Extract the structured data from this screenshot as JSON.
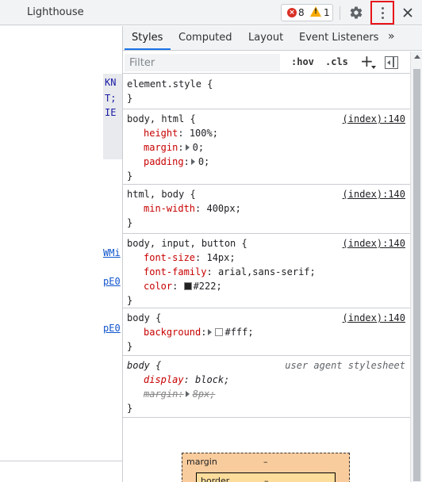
{
  "toolbar": {
    "panel_tab": "Lighthouse",
    "error_count": "8",
    "warning_count": "1",
    "icons": [
      "error-icon",
      "warning-icon",
      "gear-icon",
      "kebab-menu-icon",
      "close-icon"
    ],
    "highlight_color": "#e8151b"
  },
  "elements_pane": {
    "code_fragments": [
      "KN",
      "T;",
      "IE"
    ],
    "links": [
      "WMi",
      "pE0",
      "pE0"
    ]
  },
  "sidebar_tabs": {
    "styles": "Styles",
    "computed": "Computed",
    "layout": "Layout",
    "event_listeners": "Event Listeners",
    "more": "»"
  },
  "filter": {
    "placeholder": "Filter",
    "hov": ":hov",
    "cls": ".cls",
    "new_rule": "+"
  },
  "rules": {
    "r0": {
      "selector": "element.style {",
      "close": "}"
    },
    "r1": {
      "selector": "body, html {",
      "source": "(index):140",
      "close": "}",
      "p1": {
        "name": "height",
        "value": "100%;"
      },
      "p2": {
        "name": "margin",
        "value": "0;"
      },
      "p3": {
        "name": "padding",
        "value": "0;"
      }
    },
    "r2": {
      "selector": "html, body {",
      "source": "(index):140",
      "close": "}",
      "p1": {
        "name": "min-width",
        "value": "400px;"
      }
    },
    "r3": {
      "selector": "body, input, button {",
      "source": "(index):140",
      "close": "}",
      "p1": {
        "name": "font-size",
        "value": "14px;"
      },
      "p2": {
        "name": "font-family",
        "value": "arial,sans-serif;"
      },
      "p3": {
        "name": "color",
        "value": "#222;",
        "swatch": "#222222"
      }
    },
    "r4": {
      "selector": "body {",
      "source": "(index):140",
      "close": "}",
      "p1": {
        "name": "background",
        "value": "#fff;",
        "swatch": "#ffffff"
      }
    },
    "r5": {
      "selector": "body {",
      "source": "user agent stylesheet",
      "close": "}",
      "p1": {
        "name": "display",
        "value": "block;"
      },
      "p2": {
        "name": "margin",
        "value": "8px;"
      }
    }
  },
  "box_model": {
    "margin_label": "margin",
    "margin_value": "–",
    "border_label": "border",
    "border_value": "–"
  }
}
